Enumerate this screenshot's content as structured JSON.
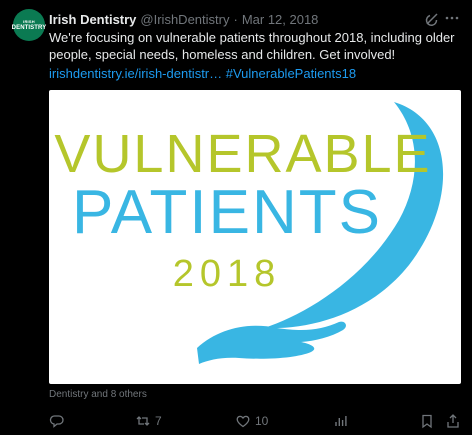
{
  "author": {
    "name": "Irish Dentistry",
    "handle": "@IrishDentistry",
    "date": "Mar 12, 2018",
    "avatar_text_top": "IRISH",
    "avatar_text_bottom": "DENTISTRY",
    "avatar_color": "#0b7a52"
  },
  "tweet": {
    "text": "We're focusing on vulnerable patients throughout 2018, including older people, special needs, homeless and children. Get involved!",
    "link": "irishdentistry.ie/irish-dentistr…",
    "hashtag": "#VulnerablePatients18"
  },
  "media": {
    "line1": "VULNERABLE",
    "line2": "PATIENTS",
    "line3": "2018",
    "color_green": "#b5c62b",
    "color_blue": "#39b6e3"
  },
  "liked_by": "Dentistry and 8 others",
  "actions": {
    "reply_count": "",
    "retweet_count": "7",
    "like_count": "10",
    "views_count": ""
  },
  "icons": {
    "grok": "grok-icon",
    "more": "more-icon",
    "reply": "reply-icon",
    "retweet": "retweet-icon",
    "like": "like-icon",
    "views": "views-icon",
    "bookmark": "bookmark-icon",
    "share": "share-icon"
  },
  "colors": {
    "background": "#000000",
    "text": "#e7e9ea",
    "muted": "#71767b",
    "link": "#1d9bf0"
  }
}
